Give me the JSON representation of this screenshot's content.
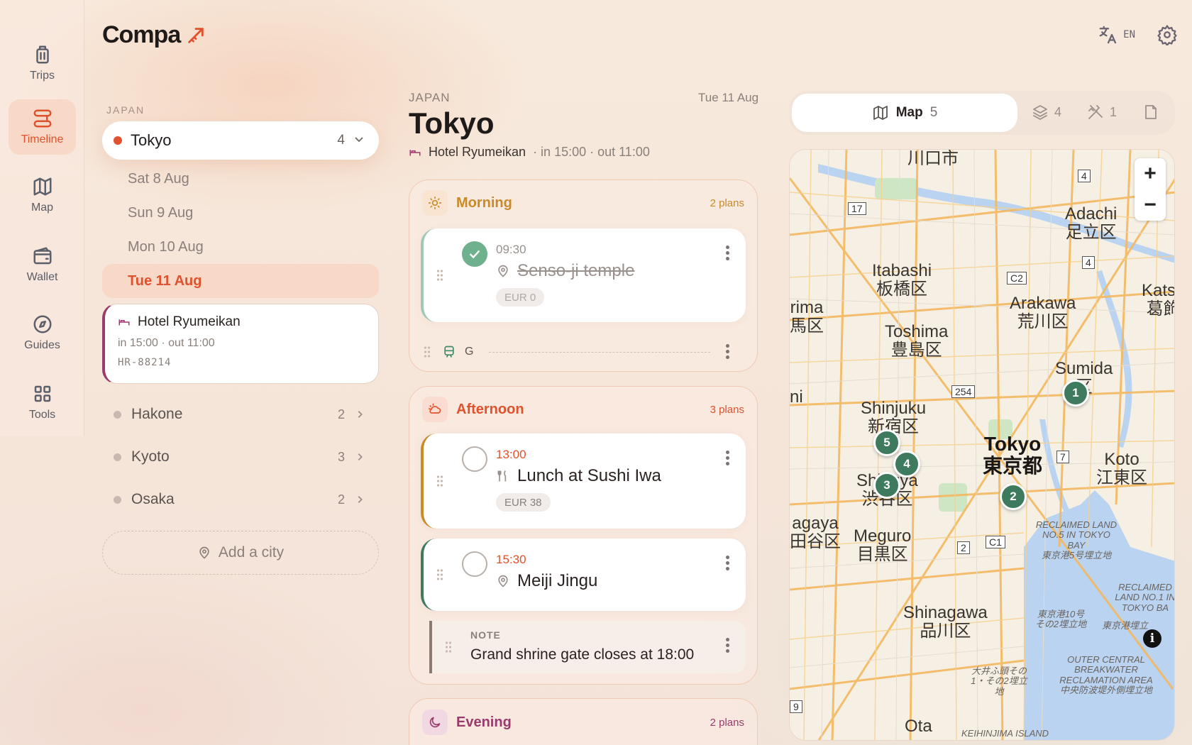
{
  "app": {
    "title": "Compa"
  },
  "header": {
    "lang": "EN"
  },
  "rail": [
    {
      "label": "Trips",
      "icon": "suitcase-icon"
    },
    {
      "label": "Timeline",
      "icon": "route-icon"
    },
    {
      "label": "Map",
      "icon": "map-icon"
    },
    {
      "label": "Wallet",
      "icon": "wallet-icon"
    },
    {
      "label": "Guides",
      "icon": "compass-icon"
    },
    {
      "label": "Tools",
      "icon": "grid-icon"
    }
  ],
  "left": {
    "country": "JAPAN",
    "selected_city": {
      "name": "Tokyo",
      "count": "4"
    },
    "dates": [
      "Sat 8 Aug",
      "Sun 9 Aug",
      "Mon 10 Aug",
      "Tue 11 Aug"
    ],
    "hotel": {
      "name": "Hotel Ryumeikan",
      "times": "in 15:00 · out 11:00",
      "code": "HR-88214"
    },
    "cities": [
      {
        "name": "Hakone",
        "count": "2"
      },
      {
        "name": "Kyoto",
        "count": "3"
      },
      {
        "name": "Osaka",
        "count": "2"
      }
    ],
    "add_city": "Add a city"
  },
  "day": {
    "country": "JAPAN",
    "date": "Tue 11 Aug",
    "city": "Tokyo",
    "hotel": "Hotel Ryumeikan",
    "hotel_times": "· in 15:00 · out 11:00",
    "morning": {
      "title": "Morning",
      "count": "2 plans",
      "plan": {
        "time": "09:30",
        "name": "Senso-ji temple",
        "price": "EUR 0"
      },
      "transit": "G"
    },
    "afternoon": {
      "title": "Afternoon",
      "count": "3 plans",
      "plans": [
        {
          "time": "13:00",
          "name": "Lunch at Sushi Iwa",
          "price": "EUR 38"
        },
        {
          "time": "15:30",
          "name": "Meiji Jingu"
        }
      ],
      "note": {
        "label": "NOTE",
        "text": "Grand shrine gate closes at 18:00"
      }
    },
    "evening": {
      "title": "Evening",
      "count": "2 plans"
    }
  },
  "right": {
    "tabs": {
      "map": "Map",
      "map_count": "5",
      "layers_count": "4",
      "tools_count": "1"
    },
    "map_labels": {
      "kawaguchi": "川口市",
      "adachi": "Adachi",
      "adachi_jp": "足立区",
      "itabashi": "Itabashi",
      "itabashi_jp": "板橋区",
      "katsu": "Katsu",
      "katsu_jp": "葛飾",
      "arakawa": "Arakawa",
      "arakawa_jp": "荒川区",
      "nerima": "rima",
      "nerima_jp": "馬区",
      "toshima": "Toshima",
      "toshima_jp": "豊島区",
      "sumida": "Sumida",
      "sumida_jp": "区",
      "ni": "ni",
      "shinjuku": "Shinjuku",
      "shinjuku_jp": "新宿区",
      "tokyo": "Tokyo",
      "tokyo_jp": "東京都",
      "koto": "Koto",
      "koto_jp": "江東区",
      "shibuya": "Shibuya",
      "shibuya_jp": "渋谷区",
      "setagaya": "agaya",
      "setagaya_jp": "田谷区",
      "meguro": "Meguro",
      "meguro_jp": "目黒区",
      "shinagawa": "Shinagawa",
      "shinagawa_jp": "品川区",
      "ota": "Ota",
      "reclaimed5": "RECLAIMED LAND NO.5 IN TOKYO BAY",
      "reclaimed5_jp": "東京港5号埋立地",
      "reclaimed1": "RECLAIMED LAND NO.1 IN TOKYO BA",
      "reclaimed10": "東京港10号 その2埋立地",
      "tokyoport": "東京港埋立",
      "breakwater": "OUTER CENTRAL BREAKWATER RECLAMATION AREA",
      "breakwater_jp": "中央防波堤外側埋立地",
      "oi": "大井ふ頭その 1・その2埋立地",
      "keihin": "KEIHINJIMA ISLAND"
    },
    "shields": [
      "17",
      "4",
      "4",
      "C2",
      "254",
      "7",
      "2",
      "C1",
      "9"
    ],
    "pins": [
      "1",
      "2",
      "3",
      "4",
      "5"
    ]
  }
}
